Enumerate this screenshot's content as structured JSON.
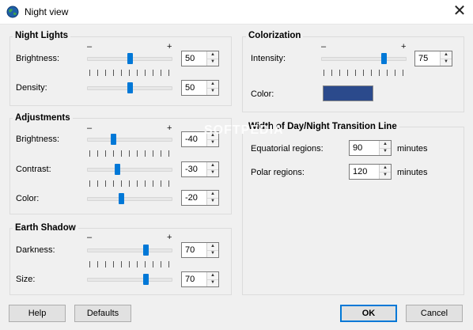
{
  "window": {
    "title": "Night view",
    "close_glyph": "✕"
  },
  "night_lights": {
    "title": "Night Lights",
    "minus": "–",
    "plus": "+",
    "brightness": {
      "label": "Brightness:",
      "value": "50",
      "level": 0.5
    },
    "density": {
      "label": "Density:",
      "value": "50",
      "level": 0.5
    }
  },
  "adjustments": {
    "title": "Adjustments",
    "minus": "–",
    "plus": "+",
    "brightness": {
      "label": "Brightness:",
      "value": "-40",
      "level": 0.3
    },
    "contrast": {
      "label": "Contrast:",
      "value": "-30",
      "level": 0.35
    },
    "color": {
      "label": "Color:",
      "value": "-20",
      "level": 0.4
    }
  },
  "earth_shadow": {
    "title": "Earth Shadow",
    "minus": "–",
    "plus": "+",
    "darkness": {
      "label": "Darkness:",
      "value": "70",
      "level": 0.7
    },
    "size": {
      "label": "Size:",
      "value": "70",
      "level": 0.7
    }
  },
  "colorization": {
    "title": "Colorization",
    "minus": "–",
    "plus": "+",
    "intensity": {
      "label": "Intensity:",
      "value": "75",
      "level": 0.75
    },
    "color": {
      "label": "Color:",
      "swatch": "#2b4a8c"
    }
  },
  "transition": {
    "title": "Width of Day/Night Transition Line",
    "equatorial": {
      "label": "Equatorial regions:",
      "value": "90",
      "unit": "minutes"
    },
    "polar": {
      "label": "Polar regions:",
      "value": "120",
      "unit": "minutes"
    }
  },
  "buttons": {
    "help": "Help",
    "defaults": "Defaults",
    "ok": "OK",
    "cancel": "Cancel"
  },
  "watermark": "SOFTPEDIA",
  "icons": {
    "app": "globe-icon",
    "close": "close-icon",
    "spin_up": "spin-up-icon",
    "spin_down": "spin-down-icon"
  },
  "colors": {
    "accent": "#0078d7",
    "swatch": "#2b4a8c"
  }
}
